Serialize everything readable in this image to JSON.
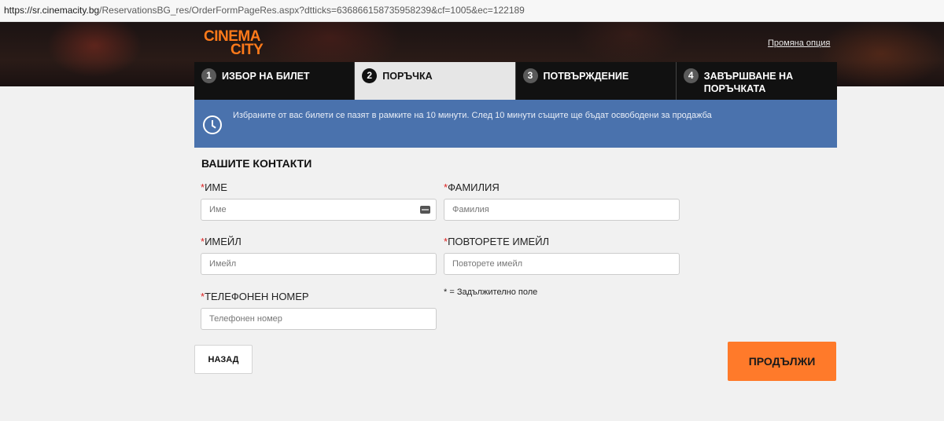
{
  "browser": {
    "url_host": "https://sr.cinemacity.bg",
    "url_path": "/ReservationsBG_res/OrderFormPageRes.aspx?dtticks=636866158735958239&cf=1005&ec=122189"
  },
  "header": {
    "logo_line1": "CINEMA",
    "logo_line2": "CITY",
    "change_option": "Промяна опция",
    "brand_color": "#ff7a1a"
  },
  "steps": [
    {
      "num": "1",
      "label": "ИЗБОР НА БИЛЕТ"
    },
    {
      "num": "2",
      "label": "ПОРЪЧКА"
    },
    {
      "num": "3",
      "label": "ПОТВЪРЖДЕНИЕ"
    },
    {
      "num": "4",
      "label": "ЗАВЪРШВАНЕ НА ПОРЪЧКАТА"
    }
  ],
  "notice": {
    "icon": "clock-icon",
    "text": "Избраните от вас билети се пазят в рамките на 10 минути. След 10 минути същите ще бъдат освободени за продажба",
    "color": "#4a72ad"
  },
  "form": {
    "title": "ВАШИТЕ КОНТАКТИ",
    "required_mark": "*",
    "first_name": {
      "label": "ИМЕ",
      "placeholder": "Име"
    },
    "last_name": {
      "label": "ФАМИЛИЯ",
      "placeholder": "Фамилия"
    },
    "email": {
      "label": "ИМЕЙЛ",
      "placeholder": "Имейл"
    },
    "email_repeat": {
      "label": "ПОВТОРЕТЕ ИМЕЙЛ",
      "placeholder": "Повторете имейл"
    },
    "phone": {
      "label": "ТЕЛЕФОНЕН НОМЕР",
      "placeholder": "Телефонен номер"
    },
    "required_note": "* = Задължително поле"
  },
  "buttons": {
    "back": "НАЗАД",
    "continue": "ПРОДЪЛЖИ",
    "continue_color": "#ff7a2a"
  }
}
